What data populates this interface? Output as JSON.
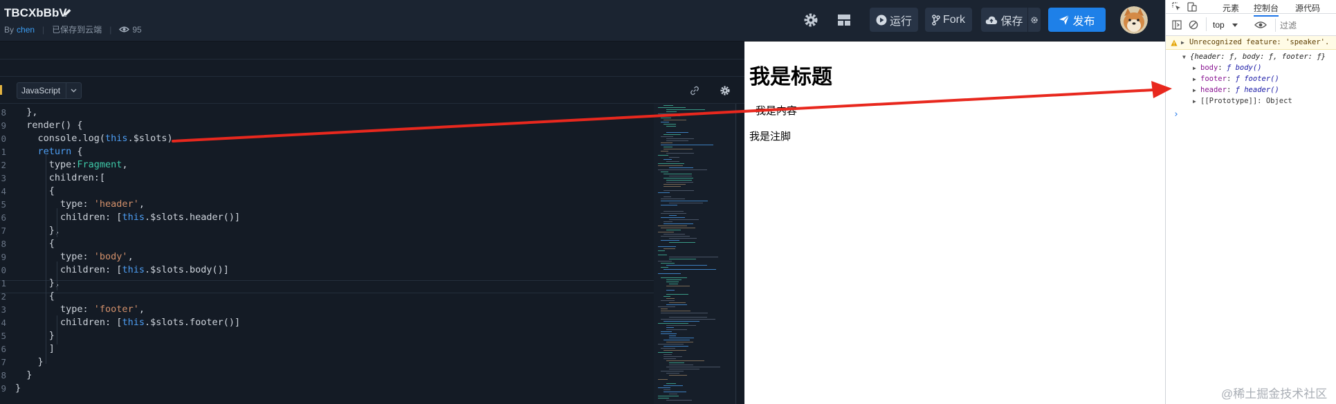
{
  "header": {
    "title": "TBCXbBbV",
    "by_label": "By",
    "author": "chen",
    "save_status": "已保存到云端",
    "view_count": "95",
    "run_label": "运行",
    "fork_label": "Fork",
    "save_label": "保存",
    "publish_label": "发布"
  },
  "editor": {
    "language": "JavaScript",
    "lines": [
      {
        "no": "8",
        "segs": [
          {
            "t": "  },"
          }
        ]
      },
      {
        "no": "9",
        "segs": [
          {
            "t": "  render() {"
          }
        ]
      },
      {
        "no": "0",
        "segs": [
          {
            "t": "    console.log("
          },
          {
            "t": "this",
            "c": "kw"
          },
          {
            "t": ".$slots)"
          }
        ]
      },
      {
        "no": "1",
        "segs": [
          {
            "t": "    "
          },
          {
            "t": "return",
            "c": "kw"
          },
          {
            "t": " {"
          }
        ]
      },
      {
        "no": "2",
        "segs": [
          {
            "t": "      type:"
          },
          {
            "t": "Fragment",
            "c": "ty"
          },
          {
            "t": ","
          }
        ]
      },
      {
        "no": "3",
        "segs": [
          {
            "t": "      children:["
          }
        ]
      },
      {
        "no": "4",
        "segs": [
          {
            "t": "      {"
          }
        ]
      },
      {
        "no": "5",
        "segs": [
          {
            "t": "        type: "
          },
          {
            "t": "'header'",
            "c": "st"
          },
          {
            "t": ","
          }
        ]
      },
      {
        "no": "6",
        "segs": [
          {
            "t": "        children: ["
          },
          {
            "t": "this",
            "c": "kw"
          },
          {
            "t": ".$slots.header()]"
          }
        ]
      },
      {
        "no": "7",
        "segs": [
          {
            "t": "      },"
          }
        ]
      },
      {
        "no": "8",
        "segs": [
          {
            "t": "      {"
          }
        ]
      },
      {
        "no": "9",
        "segs": [
          {
            "t": "        type: "
          },
          {
            "t": "'body'",
            "c": "st"
          },
          {
            "t": ","
          }
        ]
      },
      {
        "no": "0",
        "segs": [
          {
            "t": "        children: ["
          },
          {
            "t": "this",
            "c": "kw"
          },
          {
            "t": ".$slots.body()]"
          }
        ]
      },
      {
        "no": "1",
        "segs": [
          {
            "t": "      },"
          }
        ]
      },
      {
        "no": "2",
        "segs": [
          {
            "t": "      {"
          }
        ]
      },
      {
        "no": "3",
        "segs": [
          {
            "t": "        type: "
          },
          {
            "t": "'footer'",
            "c": "st"
          },
          {
            "t": ","
          }
        ]
      },
      {
        "no": "4",
        "segs": [
          {
            "t": "        children: ["
          },
          {
            "t": "this",
            "c": "kw"
          },
          {
            "t": ".$slots.footer()]"
          }
        ]
      },
      {
        "no": "5",
        "segs": [
          {
            "t": "      }"
          }
        ]
      },
      {
        "no": "6",
        "segs": [
          {
            "t": "      ]"
          }
        ]
      },
      {
        "no": "7",
        "segs": [
          {
            "t": "    }"
          }
        ]
      },
      {
        "no": "8",
        "segs": [
          {
            "t": "  }"
          }
        ]
      },
      {
        "no": "9",
        "segs": [
          {
            "t": "}"
          }
        ]
      }
    ]
  },
  "preview": {
    "heading": "我是标题",
    "body": "我是内容",
    "footer": "我是注脚"
  },
  "devtools": {
    "tabs": {
      "elements": "元素",
      "console": "控制台",
      "sources": "源代码"
    },
    "context": "top",
    "filter_placeholder": "过滤",
    "warning": "Unrecognized feature: 'speaker'.",
    "object_summary": "{header: ƒ, body: ƒ, footer: ƒ}",
    "props": [
      {
        "key": "body",
        "val": "ƒ body()"
      },
      {
        "key": "footer",
        "val": "ƒ footer()"
      },
      {
        "key": "header",
        "val": "ƒ header()"
      }
    ],
    "prototype": "[[Prototype]]: Object",
    "prompt": "›"
  },
  "watermark": "@稀土掘金技术社区",
  "colors": {
    "accent": "#1e80e8",
    "arrow": "#e8281e",
    "editor_bg": "#141b25",
    "header_bg": "#1b2431"
  }
}
